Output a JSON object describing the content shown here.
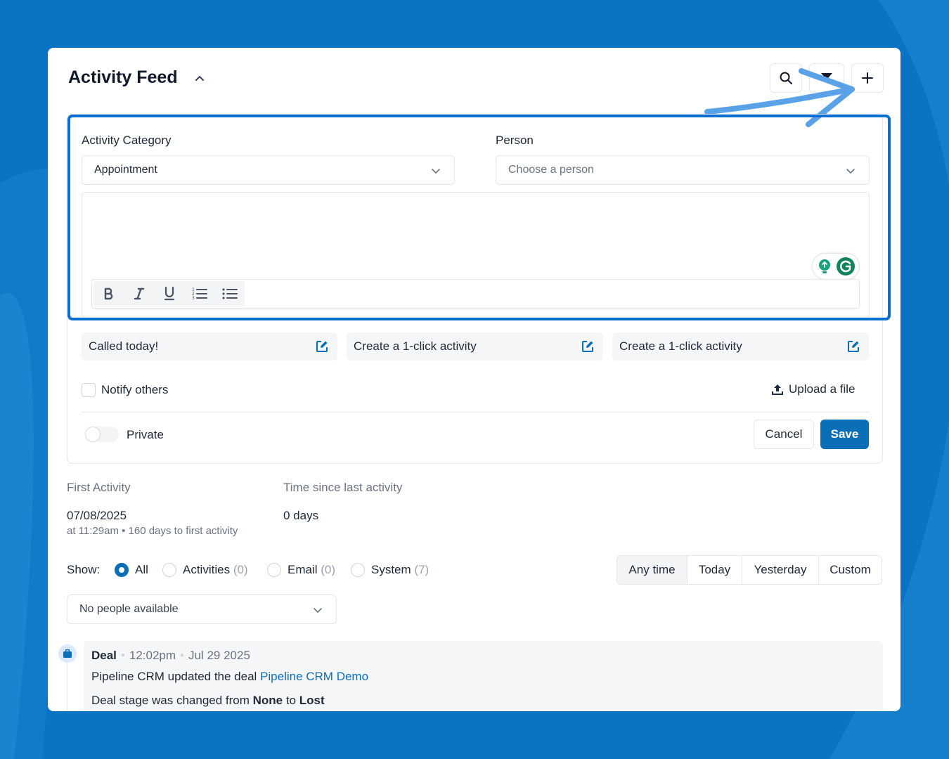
{
  "colors": {
    "background": "#0a74c4",
    "accent": "#0b6fb8",
    "highlight_outline": "#0a6fd1",
    "arrow": "#5aa2e8"
  },
  "header": {
    "title": "Activity Feed",
    "icons": [
      "search-icon",
      "filter-icon",
      "plus-icon"
    ]
  },
  "form": {
    "category_label": "Activity Category",
    "category_value": "Appointment",
    "person_label": "Person",
    "person_placeholder": "Choose a person",
    "toolbar": [
      "bold-icon",
      "italic-icon",
      "underline-icon",
      "ordered-list-icon",
      "bullet-list-icon"
    ],
    "quick_activities": [
      {
        "label": "Called today!"
      },
      {
        "label": "Create a 1-click activity"
      },
      {
        "label": "Create a 1-click activity"
      }
    ],
    "notify_label": "Notify others",
    "upload_label": "Upload a file",
    "private_label": "Private",
    "cancel_label": "Cancel",
    "save_label": "Save"
  },
  "stats": {
    "first_activity_label": "First Activity",
    "first_activity_date": "07/08/2025",
    "first_activity_detail": "at 11:29am • 160 days to first activity",
    "time_since_label": "Time since last activity",
    "time_since_value": "0 days"
  },
  "filters": {
    "show_label": "Show:",
    "options": [
      {
        "label": "All",
        "count": "",
        "selected": true
      },
      {
        "label": "Activities",
        "count": "(0)",
        "selected": false
      },
      {
        "label": "Email",
        "count": "(0)",
        "selected": false
      },
      {
        "label": "System",
        "count": "(7)",
        "selected": false
      }
    ],
    "time_ranges": [
      "Any time",
      "Today",
      "Yesterday",
      "Custom"
    ],
    "active_time_range": "Any time",
    "people_select": "No people available"
  },
  "feed": {
    "items": [
      {
        "type": "Deal",
        "time": "12:02pm",
        "date": "Jul 29 2025",
        "text_prefix": "Pipeline CRM updated the deal ",
        "link_text": "Pipeline CRM Demo",
        "change_prefix": "Deal stage was changed from ",
        "from": "None",
        "change_mid": " to ",
        "to": "Lost"
      }
    ]
  }
}
